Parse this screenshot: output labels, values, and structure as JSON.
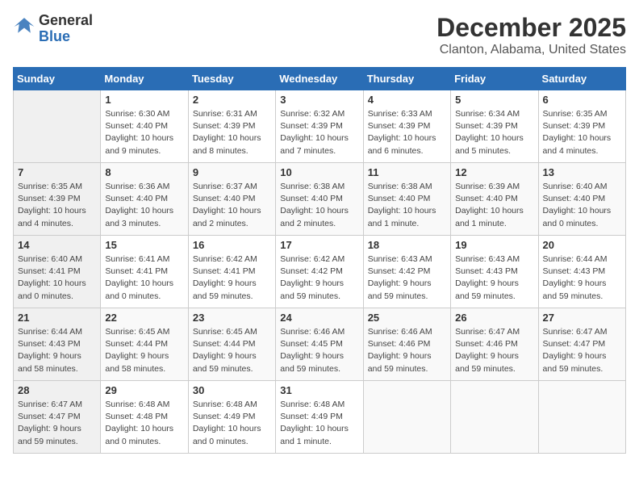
{
  "logo": {
    "text_general": "General",
    "text_blue": "Blue"
  },
  "title": {
    "month": "December 2025",
    "location": "Clanton, Alabama, United States"
  },
  "weekdays": [
    "Sunday",
    "Monday",
    "Tuesday",
    "Wednesday",
    "Thursday",
    "Friday",
    "Saturday"
  ],
  "weeks": [
    [
      {
        "day": "",
        "sunrise": "",
        "sunset": "",
        "daylight": ""
      },
      {
        "day": "1",
        "sunrise": "Sunrise: 6:30 AM",
        "sunset": "Sunset: 4:40 PM",
        "daylight": "Daylight: 10 hours and 9 minutes."
      },
      {
        "day": "2",
        "sunrise": "Sunrise: 6:31 AM",
        "sunset": "Sunset: 4:39 PM",
        "daylight": "Daylight: 10 hours and 8 minutes."
      },
      {
        "day": "3",
        "sunrise": "Sunrise: 6:32 AM",
        "sunset": "Sunset: 4:39 PM",
        "daylight": "Daylight: 10 hours and 7 minutes."
      },
      {
        "day": "4",
        "sunrise": "Sunrise: 6:33 AM",
        "sunset": "Sunset: 4:39 PM",
        "daylight": "Daylight: 10 hours and 6 minutes."
      },
      {
        "day": "5",
        "sunrise": "Sunrise: 6:34 AM",
        "sunset": "Sunset: 4:39 PM",
        "daylight": "Daylight: 10 hours and 5 minutes."
      },
      {
        "day": "6",
        "sunrise": "Sunrise: 6:35 AM",
        "sunset": "Sunset: 4:39 PM",
        "daylight": "Daylight: 10 hours and 4 minutes."
      }
    ],
    [
      {
        "day": "7",
        "sunrise": "Sunrise: 6:35 AM",
        "sunset": "Sunset: 4:39 PM",
        "daylight": "Daylight: 10 hours and 4 minutes."
      },
      {
        "day": "8",
        "sunrise": "Sunrise: 6:36 AM",
        "sunset": "Sunset: 4:40 PM",
        "daylight": "Daylight: 10 hours and 3 minutes."
      },
      {
        "day": "9",
        "sunrise": "Sunrise: 6:37 AM",
        "sunset": "Sunset: 4:40 PM",
        "daylight": "Daylight: 10 hours and 2 minutes."
      },
      {
        "day": "10",
        "sunrise": "Sunrise: 6:38 AM",
        "sunset": "Sunset: 4:40 PM",
        "daylight": "Daylight: 10 hours and 2 minutes."
      },
      {
        "day": "11",
        "sunrise": "Sunrise: 6:38 AM",
        "sunset": "Sunset: 4:40 PM",
        "daylight": "Daylight: 10 hours and 1 minute."
      },
      {
        "day": "12",
        "sunrise": "Sunrise: 6:39 AM",
        "sunset": "Sunset: 4:40 PM",
        "daylight": "Daylight: 10 hours and 1 minute."
      },
      {
        "day": "13",
        "sunrise": "Sunrise: 6:40 AM",
        "sunset": "Sunset: 4:40 PM",
        "daylight": "Daylight: 10 hours and 0 minutes."
      }
    ],
    [
      {
        "day": "14",
        "sunrise": "Sunrise: 6:40 AM",
        "sunset": "Sunset: 4:41 PM",
        "daylight": "Daylight: 10 hours and 0 minutes."
      },
      {
        "day": "15",
        "sunrise": "Sunrise: 6:41 AM",
        "sunset": "Sunset: 4:41 PM",
        "daylight": "Daylight: 10 hours and 0 minutes."
      },
      {
        "day": "16",
        "sunrise": "Sunrise: 6:42 AM",
        "sunset": "Sunset: 4:41 PM",
        "daylight": "Daylight: 9 hours and 59 minutes."
      },
      {
        "day": "17",
        "sunrise": "Sunrise: 6:42 AM",
        "sunset": "Sunset: 4:42 PM",
        "daylight": "Daylight: 9 hours and 59 minutes."
      },
      {
        "day": "18",
        "sunrise": "Sunrise: 6:43 AM",
        "sunset": "Sunset: 4:42 PM",
        "daylight": "Daylight: 9 hours and 59 minutes."
      },
      {
        "day": "19",
        "sunrise": "Sunrise: 6:43 AM",
        "sunset": "Sunset: 4:43 PM",
        "daylight": "Daylight: 9 hours and 59 minutes."
      },
      {
        "day": "20",
        "sunrise": "Sunrise: 6:44 AM",
        "sunset": "Sunset: 4:43 PM",
        "daylight": "Daylight: 9 hours and 59 minutes."
      }
    ],
    [
      {
        "day": "21",
        "sunrise": "Sunrise: 6:44 AM",
        "sunset": "Sunset: 4:43 PM",
        "daylight": "Daylight: 9 hours and 58 minutes."
      },
      {
        "day": "22",
        "sunrise": "Sunrise: 6:45 AM",
        "sunset": "Sunset: 4:44 PM",
        "daylight": "Daylight: 9 hours and 58 minutes."
      },
      {
        "day": "23",
        "sunrise": "Sunrise: 6:45 AM",
        "sunset": "Sunset: 4:44 PM",
        "daylight": "Daylight: 9 hours and 59 minutes."
      },
      {
        "day": "24",
        "sunrise": "Sunrise: 6:46 AM",
        "sunset": "Sunset: 4:45 PM",
        "daylight": "Daylight: 9 hours and 59 minutes."
      },
      {
        "day": "25",
        "sunrise": "Sunrise: 6:46 AM",
        "sunset": "Sunset: 4:46 PM",
        "daylight": "Daylight: 9 hours and 59 minutes."
      },
      {
        "day": "26",
        "sunrise": "Sunrise: 6:47 AM",
        "sunset": "Sunset: 4:46 PM",
        "daylight": "Daylight: 9 hours and 59 minutes."
      },
      {
        "day": "27",
        "sunrise": "Sunrise: 6:47 AM",
        "sunset": "Sunset: 4:47 PM",
        "daylight": "Daylight: 9 hours and 59 minutes."
      }
    ],
    [
      {
        "day": "28",
        "sunrise": "Sunrise: 6:47 AM",
        "sunset": "Sunset: 4:47 PM",
        "daylight": "Daylight: 9 hours and 59 minutes."
      },
      {
        "day": "29",
        "sunrise": "Sunrise: 6:48 AM",
        "sunset": "Sunset: 4:48 PM",
        "daylight": "Daylight: 10 hours and 0 minutes."
      },
      {
        "day": "30",
        "sunrise": "Sunrise: 6:48 AM",
        "sunset": "Sunset: 4:49 PM",
        "daylight": "Daylight: 10 hours and 0 minutes."
      },
      {
        "day": "31",
        "sunrise": "Sunrise: 6:48 AM",
        "sunset": "Sunset: 4:49 PM",
        "daylight": "Daylight: 10 hours and 1 minute."
      },
      {
        "day": "",
        "sunrise": "",
        "sunset": "",
        "daylight": ""
      },
      {
        "day": "",
        "sunrise": "",
        "sunset": "",
        "daylight": ""
      },
      {
        "day": "",
        "sunrise": "",
        "sunset": "",
        "daylight": ""
      }
    ]
  ]
}
